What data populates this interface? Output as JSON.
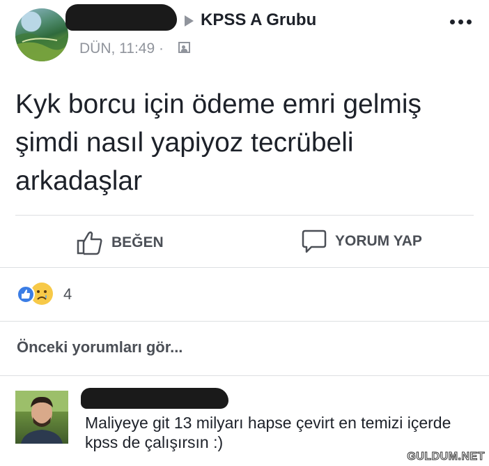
{
  "post": {
    "group_name": "KPSS A Grubu",
    "timestamp": "DÜN, 11:49 ·",
    "text": "Kyk borcu için ödeme emri gelmiş şimdi nasıl yapiyoz tecrübeli arkadaşlar"
  },
  "actions": {
    "like_label": "BEĞEN",
    "comment_label": "YORUM YAP"
  },
  "reactions": {
    "count": "4",
    "types": [
      "like-icon",
      "sad-icon"
    ]
  },
  "comments": {
    "view_previous_label": "Önceki yorumları gör...",
    "items": [
      {
        "text": "Maliyeye git 13 milyarı hapse çevirt en temizi içerde kpss de çalışırsın :)"
      }
    ]
  },
  "watermark": "GULDUM.NET",
  "colors": {
    "accent_blue": "#3b7de5",
    "text_primary": "#1d2129",
    "text_secondary": "#90949c",
    "divider": "#dddfe2"
  }
}
